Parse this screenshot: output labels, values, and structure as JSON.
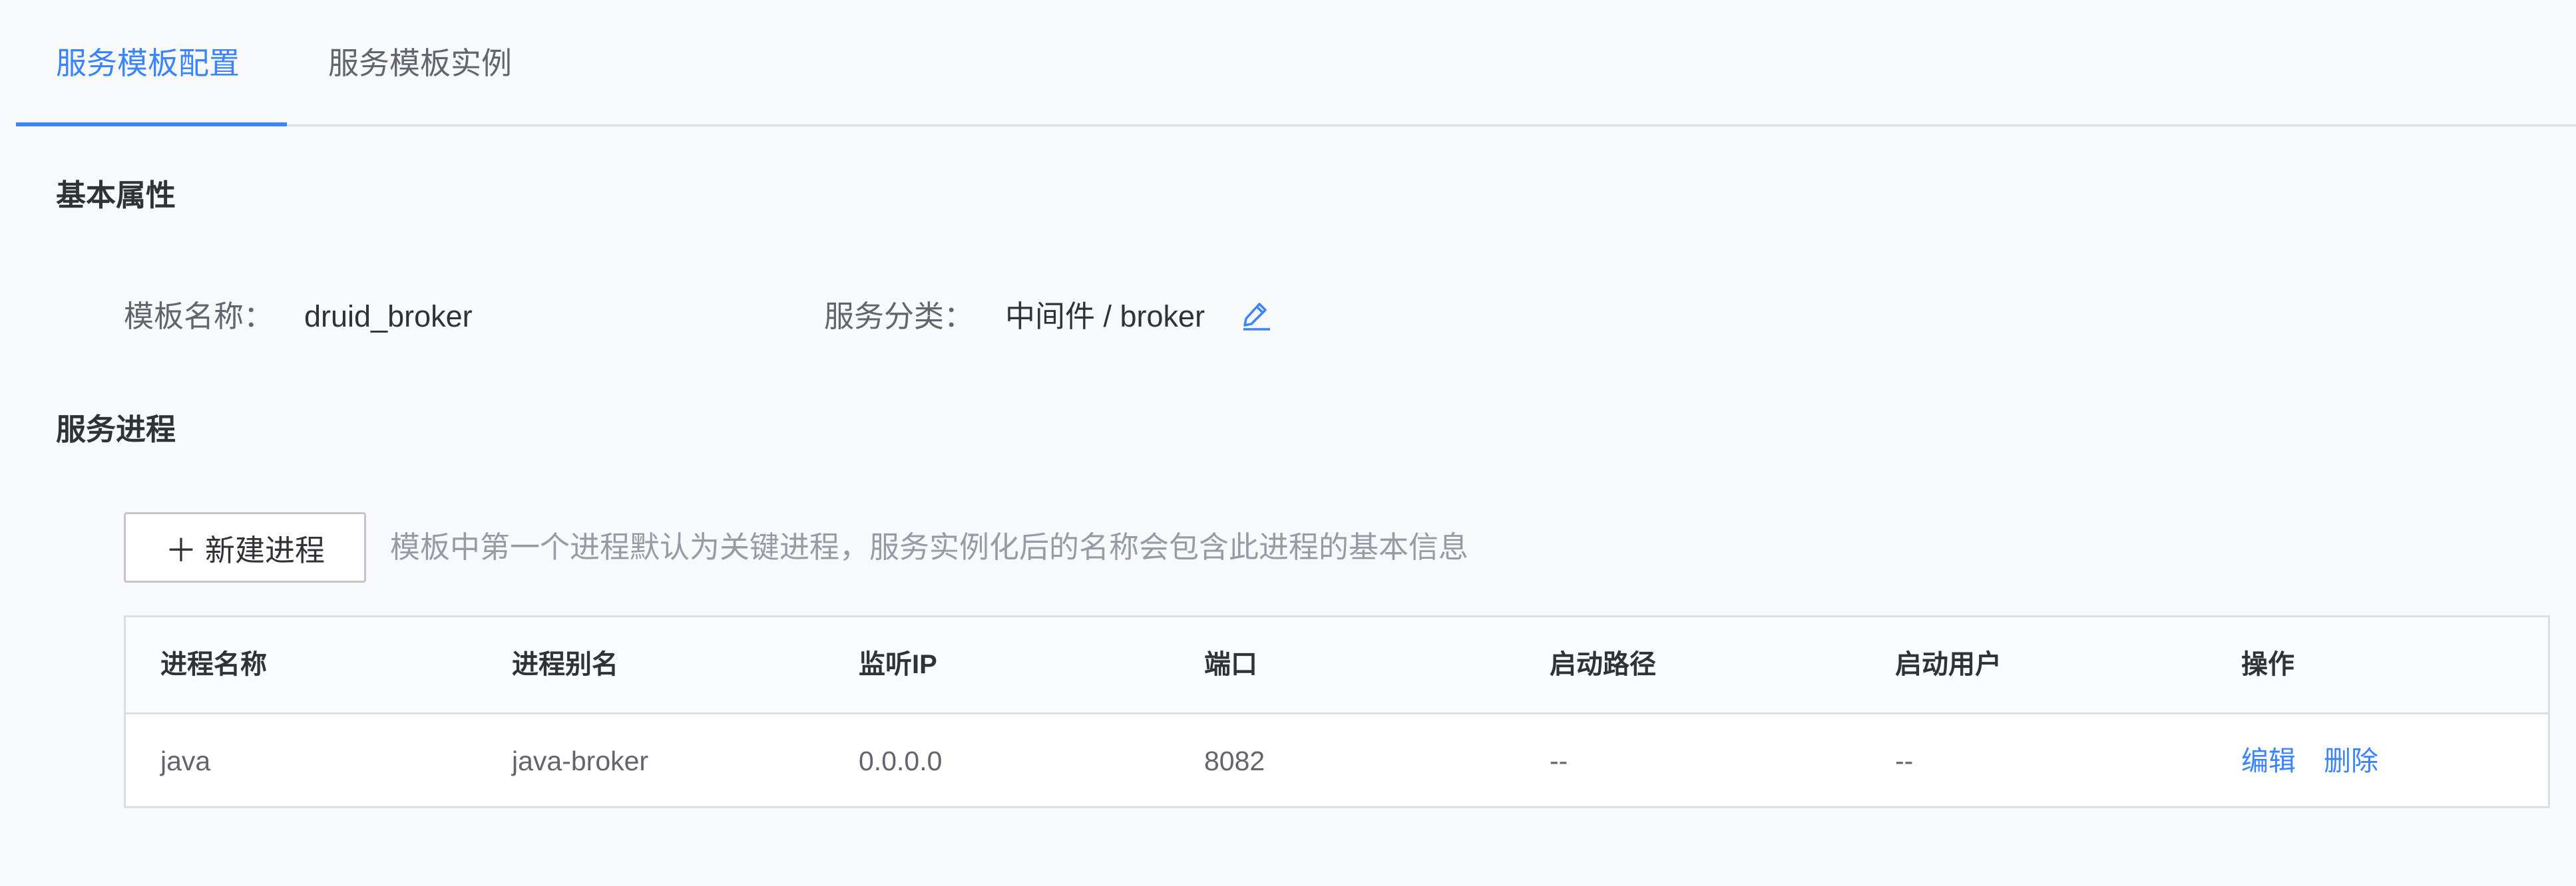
{
  "tabs": [
    {
      "label": "服务模板配置",
      "active": true
    },
    {
      "label": "服务模板实例",
      "active": false
    }
  ],
  "basic": {
    "title": "基本属性",
    "template_name_label": "模板名称：",
    "template_name_value": "druid_broker",
    "category_label": "服务分类：",
    "category_value": "中间件 / broker"
  },
  "process": {
    "title": "服务进程",
    "new_button_label": "新建进程",
    "hint": "模板中第一个进程默认为关键进程，服务实例化后的名称会包含此进程的基本信息",
    "columns": [
      "进程名称",
      "进程别名",
      "监听IP",
      "端口",
      "启动路径",
      "启动用户",
      "操作"
    ],
    "rows": [
      {
        "name": "java",
        "alias": "java-broker",
        "ip": "0.0.0.0",
        "port": "8082",
        "path": "--",
        "user": "--",
        "actions": [
          "编辑",
          "删除"
        ]
      }
    ]
  },
  "colors": {
    "accent": "#3a84ff",
    "text_primary": "#313238",
    "text_secondary": "#63656e",
    "text_hint": "#979ba5",
    "border": "#dcdee5",
    "background": "#f8f9fb"
  },
  "icons": {
    "edit": "pencil-icon",
    "add": "plus-icon"
  }
}
